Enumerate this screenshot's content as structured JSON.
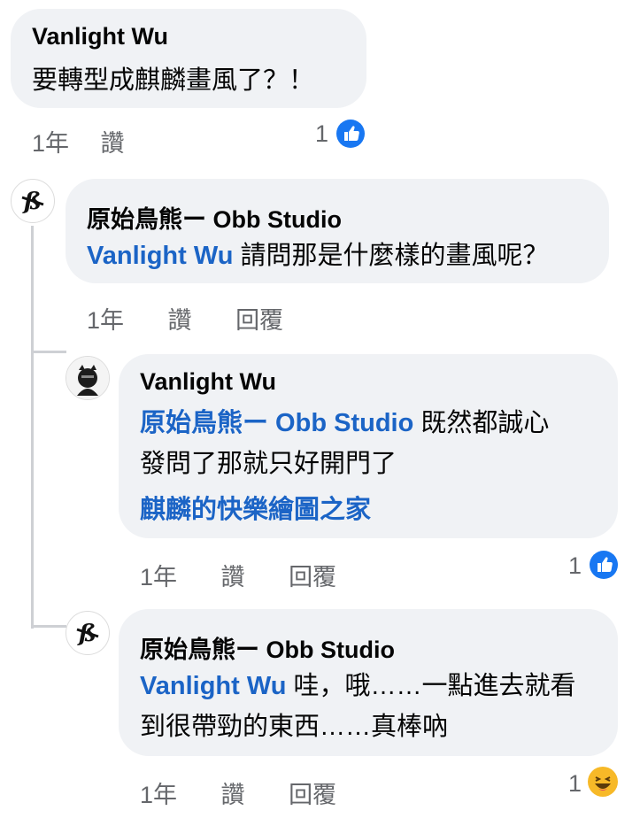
{
  "comments": [
    {
      "author": "Vanlight Wu",
      "text": "要轉型成麒麟畫風了？！",
      "time": "1年",
      "like": "讚",
      "reaction_count": "1",
      "reaction_icon": "like-icon"
    },
    {
      "author": "原始鳥熊ー Obb Studio",
      "mention": "Vanlight Wu",
      "text": "請問那是什麼樣的畫風呢？",
      "time": "1年",
      "like": "讚",
      "reply": "回覆"
    },
    {
      "author": "Vanlight Wu",
      "mention": "原始鳥熊ー Obb Studio",
      "text_line1": "既然都誠心",
      "text_line2": "發問了那就只好開門了",
      "link": "麒麟的快樂繪圖之家",
      "time": "1年",
      "like": "讚",
      "reply": "回覆",
      "reaction_count": "1",
      "reaction_icon": "like-icon"
    },
    {
      "author": "原始鳥熊ー Obb Studio",
      "mention": "Vanlight Wu",
      "text_line1": "哇，哦……一點進去就看",
      "text_line2": "到很帶勁的東西……真棒吶",
      "time": "1年",
      "like": "讚",
      "reply": "回覆",
      "reaction_count": "1",
      "reaction_icon": "haha-icon"
    }
  ],
  "colors": {
    "bubble": "#f0f2f5",
    "mention": "#1b64c6",
    "meta": "#65676b",
    "like_blue": "#1877f2"
  }
}
